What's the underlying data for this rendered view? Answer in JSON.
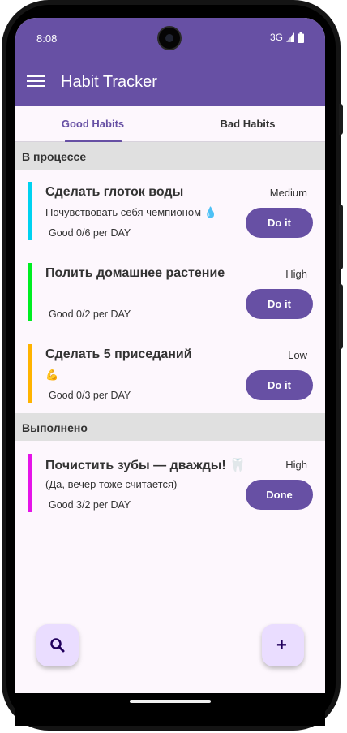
{
  "status_bar": {
    "time": "8:08",
    "network": "3G"
  },
  "app_bar": {
    "title": "Habit Tracker"
  },
  "tabs": [
    {
      "label": "Good Habits",
      "selected": true
    },
    {
      "label": "Bad Habits",
      "selected": false
    }
  ],
  "sections": {
    "in_progress": "В процессе",
    "done": "Выполнено"
  },
  "habits": [
    {
      "title": "Сделать глоток воды",
      "subtitle": "Почувствовать себя чемпионом 💧",
      "progress": "Good 0/6 per DAY",
      "priority": "Medium",
      "button": "Do it",
      "color": "#00d2f0"
    },
    {
      "title": "Полить домашнее растение",
      "subtitle": "",
      "progress": "Good 0/2 per DAY",
      "priority": "High",
      "button": "Do it",
      "color": "#00ee22"
    },
    {
      "title": "Сделать 5 приседаний",
      "subtitle": "💪",
      "progress": "Good 0/3 per DAY",
      "priority": "Low",
      "button": "Do it",
      "color": "#ffb300"
    },
    {
      "title": "Почистить зубы — дважды! 🦷",
      "subtitle": "(Да, вечер тоже считается)",
      "progress": "Good 3/2 per DAY",
      "priority": "High",
      "button": "Done",
      "color": "#e514e8"
    }
  ],
  "colors": {
    "primary": "#6750a4",
    "fab_background": "#eaddff",
    "section_background": "#e0e0e0"
  },
  "fabs": {
    "search_icon": "search-icon",
    "add_icon": "plus-icon",
    "add_label": "+"
  }
}
